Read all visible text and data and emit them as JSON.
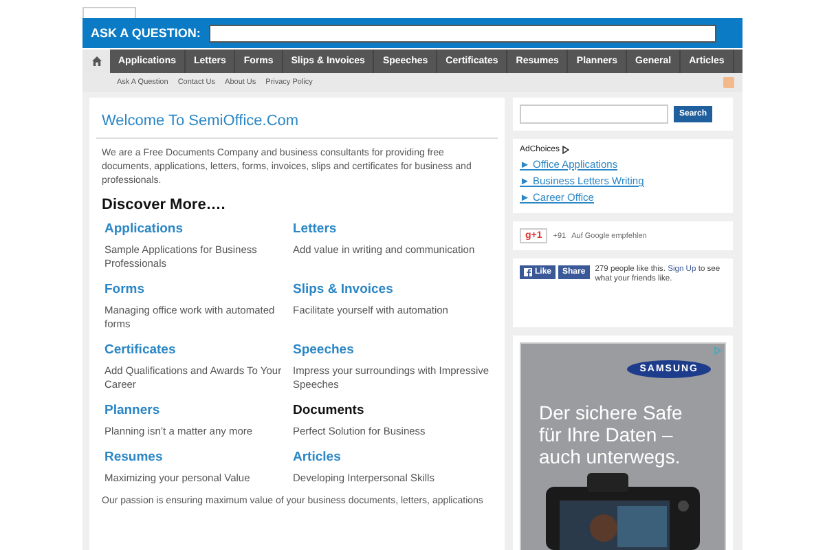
{
  "ask_bar": {
    "label": "ASK A QUESTION:"
  },
  "nav": {
    "items": [
      {
        "label": "Applications",
        "selected": false
      },
      {
        "label": "Letters",
        "selected": false
      },
      {
        "label": "Forms",
        "selected": false
      },
      {
        "label": "Slips & Invoices",
        "selected": false
      },
      {
        "label": "Speeches",
        "selected": false
      },
      {
        "label": "Certificates",
        "selected": false
      },
      {
        "label": "Resumes",
        "selected": false
      },
      {
        "label": "Planners",
        "selected": false
      },
      {
        "label": "General",
        "selected": false
      },
      {
        "label": "Articles",
        "selected": false
      }
    ]
  },
  "subnav": [
    "Ask A Question",
    "Contact Us",
    "About Us",
    "Privacy Policy"
  ],
  "main": {
    "title": "Welcome To SemiOffice.Com",
    "intro": "We are a Free Documents Company and business consultants for providing free documents, applications, letters, forms, invoices, slips and certificates for business and professionals.",
    "discover": "Discover More….",
    "sections": [
      {
        "title": "Applications",
        "link": true,
        "text": "Sample Applications for Business Professionals"
      },
      {
        "title": "Letters",
        "link": true,
        "text": "Add value in writing and communication"
      },
      {
        "title": "Forms",
        "link": true,
        "text": "Managing office work with automated forms"
      },
      {
        "title": "Slips & Invoices",
        "link": true,
        "text": "Facilitate yourself with automation"
      },
      {
        "title": "Certificates",
        "link": true,
        "text": "Add Qualifications  and Awards To Your Career"
      },
      {
        "title": "Speeches",
        "link": true,
        "text": "Impress your surroundings with Impressive Speeches"
      },
      {
        "title": "Planners",
        "link": true,
        "text": "Planning isn’t a matter any more"
      },
      {
        "title": "Documents",
        "link": false,
        "text": "Perfect Solution for Business"
      },
      {
        "title": "Resumes",
        "link": true,
        "text": "Maximizing your personal Value"
      },
      {
        "title": "Articles",
        "link": true,
        "text": "Developing Interpersonal Skills"
      }
    ],
    "footer_text": "Our passion is ensuring maximum value of your business documents, letters, applications"
  },
  "sidebar": {
    "search_button": "Search",
    "adchoices": "AdChoices",
    "ad_links": [
      "► Office Applications",
      "► Business Letters Writing",
      "► Career Office"
    ],
    "gplus": {
      "button": "g+1",
      "count": "+91",
      "text": "Auf Google empfehlen"
    },
    "facebook": {
      "like": "Like",
      "share": "Share",
      "text_before": "279 people like this.",
      "signup": "Sign Up",
      "text_after": "to see what your friends like."
    },
    "banner": {
      "brand": "SAMSUNG",
      "headline": "Der sichere Safe für Ihre Daten – auch unterwegs."
    }
  }
}
